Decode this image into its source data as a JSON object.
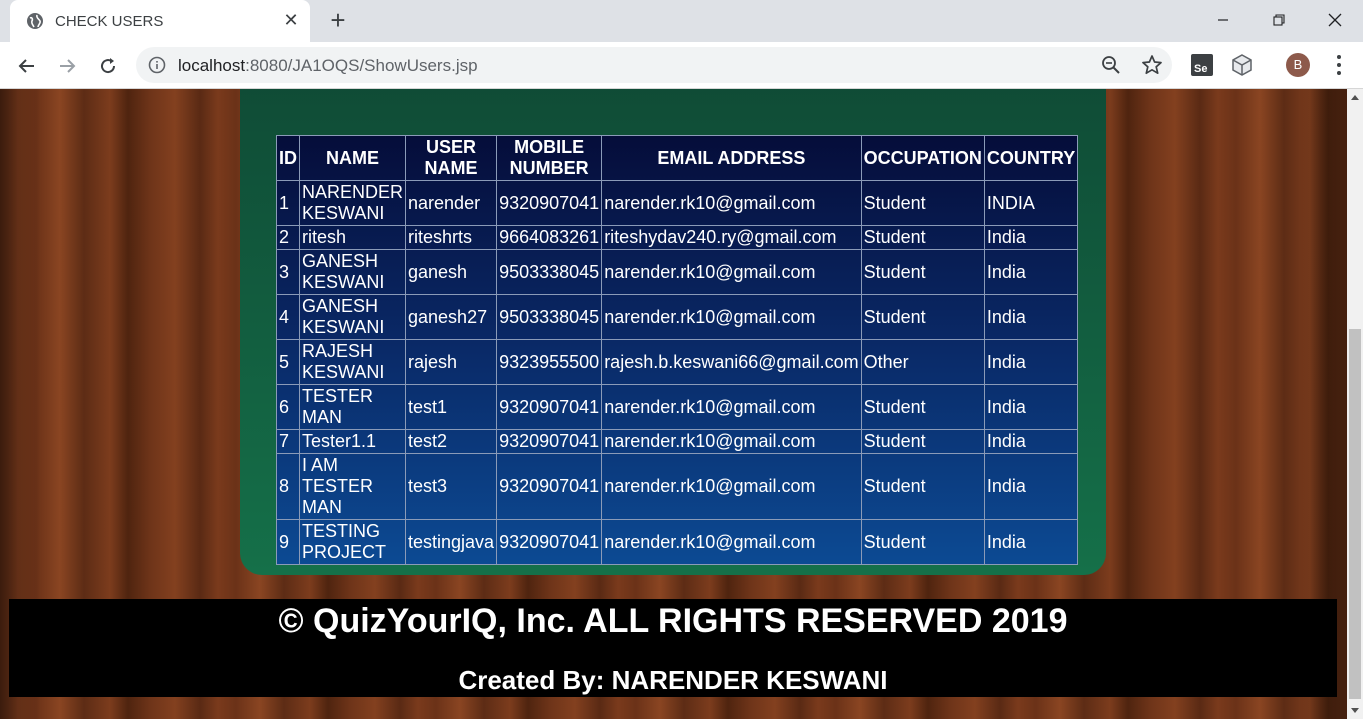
{
  "browser": {
    "tab_title": "CHECK USERS",
    "url_host": "localhost",
    "url_rest": ":8080/JA1OQS/ShowUsers.jsp",
    "profile_initial": "B",
    "icons": [
      "globe-icon",
      "close-icon",
      "plus-icon",
      "minimize-icon",
      "restore-icon",
      "window-close-icon",
      "back-icon",
      "forward-icon",
      "reload-icon",
      "info-icon",
      "zoom-icon",
      "star-icon",
      "selenium-icon",
      "extension-cube-icon",
      "menu-dots-icon"
    ]
  },
  "table": {
    "headers": {
      "id": "ID",
      "name": "NAME",
      "username_l1": "USER",
      "username_l2": "NAME",
      "mobile_l1": "MOBILE",
      "mobile_l2": "NUMBER",
      "email": "EMAIL ADDRESS",
      "occupation": "OCCUPATION",
      "country": "COUNTRY"
    },
    "rows": [
      {
        "id": "1",
        "name_l1": "NARENDER",
        "name_l2": "KESWANI",
        "username": "narender",
        "mobile": "9320907041",
        "email": "narender.rk10@gmail.com",
        "occupation": "Student",
        "country": "INDIA"
      },
      {
        "id": "2",
        "name": "ritesh",
        "username": "riteshrts",
        "mobile": "9664083261",
        "email": "riteshydav240.ry@gmail.com",
        "occupation": "Student",
        "country": "India"
      },
      {
        "id": "3",
        "name_l1": "GANESH",
        "name_l2": "KESWANI",
        "username": "ganesh",
        "mobile": "9503338045",
        "email": "narender.rk10@gmail.com",
        "occupation": "Student",
        "country": "India"
      },
      {
        "id": "4",
        "name_l1": "GANESH",
        "name_l2": "KESWANI",
        "username": "ganesh27",
        "mobile": "9503338045",
        "email": "narender.rk10@gmail.com",
        "occupation": "Student",
        "country": "India"
      },
      {
        "id": "5",
        "name_l1": "RAJESH",
        "name_l2": "KESWANI",
        "username": "rajesh",
        "mobile": "9323955500",
        "email": "rajesh.b.keswani66@gmail.com",
        "occupation": "Other",
        "country": "India"
      },
      {
        "id": "6",
        "name_l1": "TESTER",
        "name_l2": "MAN",
        "username": "test1",
        "mobile": "9320907041",
        "email": "narender.rk10@gmail.com",
        "occupation": "Student",
        "country": "India"
      },
      {
        "id": "7",
        "name": "Tester1.1",
        "username": "test2",
        "mobile": "9320907041",
        "email": "narender.rk10@gmail.com",
        "occupation": "Student",
        "country": "India"
      },
      {
        "id": "8",
        "name_l1": "I AM",
        "name_l2": "TESTER",
        "name_l3": "MAN",
        "username": "test3",
        "mobile": "9320907041",
        "email": "narender.rk10@gmail.com",
        "occupation": "Student",
        "country": "India"
      },
      {
        "id": "9",
        "name_l1": "TESTING",
        "name_l2": "PROJECT",
        "username": "testingjava",
        "mobile": "9320907041",
        "email": "narender.rk10@gmail.com",
        "occupation": "Student",
        "country": "India"
      }
    ]
  },
  "footer": {
    "copyright": "© QuizYourIQ, Inc. ALL RIGHTS RESERVED 2019",
    "credit": "Created By: NARENDER KESWANI"
  },
  "colors": {
    "panel_green": "#157049",
    "table_navy": "#050d3a",
    "table_blue": "#0c4a93",
    "footer_bg": "#000000"
  }
}
